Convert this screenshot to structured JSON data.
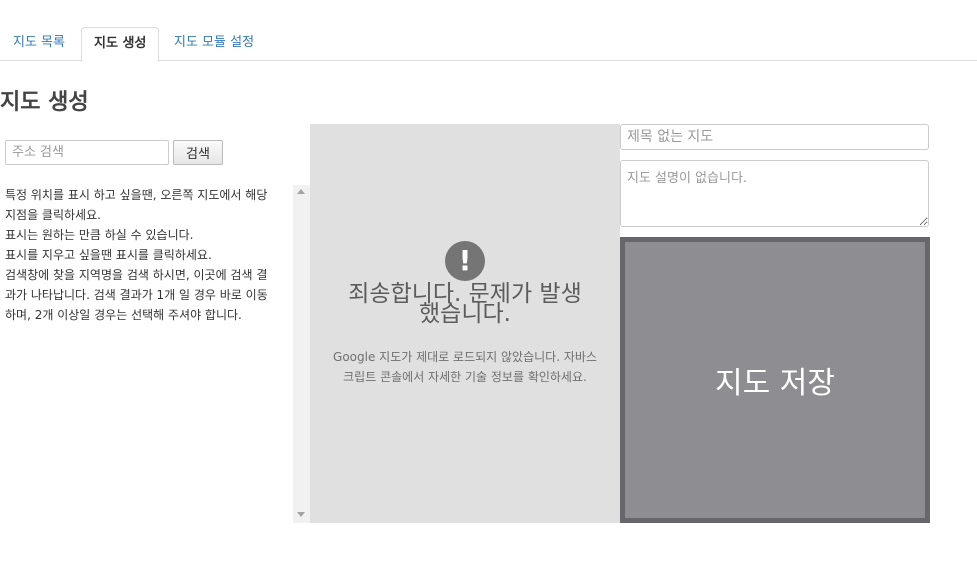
{
  "tabs": [
    {
      "label": "지도 목록",
      "active": false
    },
    {
      "label": "지도 생성",
      "active": true
    },
    {
      "label": "지도 모듈 설정",
      "active": false
    }
  ],
  "page": {
    "title": "지도 생성"
  },
  "search": {
    "placeholder": "주소 검색",
    "value": "",
    "button_label": "검색"
  },
  "help": {
    "lines": [
      "특정 위치를 표시 하고 싶을땐, 오른쪽 지도에서 해당",
      "지점을 클릭하세요.",
      "표시는 원하는 만큼 하실 수 있습니다.",
      "표시를 지우고 싶을땐 표시를 클릭하세요.",
      "검색창에 찾을 지역명을 검색 하시면, 이곳에 검색 결",
      "과가 나타납니다. 검색 결과가 1개 일 경우 바로 이동",
      "하며, 2개 이상일 경우는 선택해 주셔야 합니다."
    ]
  },
  "map": {
    "error_icon": "!",
    "error_title": "죄송합니다. 문제가 발생했습니다.",
    "error_desc": "Google 지도가 제대로 로드되지 않았습니다. 자바스크립트 콘솔에서 자세한 기술 정보를 확인하세요."
  },
  "form": {
    "title_placeholder": "제목 없는 지도",
    "title_value": "",
    "desc_placeholder": "지도 설명이 없습니다.",
    "save_label": "지도 저장"
  },
  "colors": {
    "link": "#337ab7",
    "save_bg": "#8e8d92",
    "save_border": "#67676b",
    "map_bg": "#e0e0e0"
  },
  "icons": {
    "error": "exclamation-circle-icon",
    "scroll_up": "triangle-up-icon",
    "scroll_down": "triangle-down-icon"
  }
}
